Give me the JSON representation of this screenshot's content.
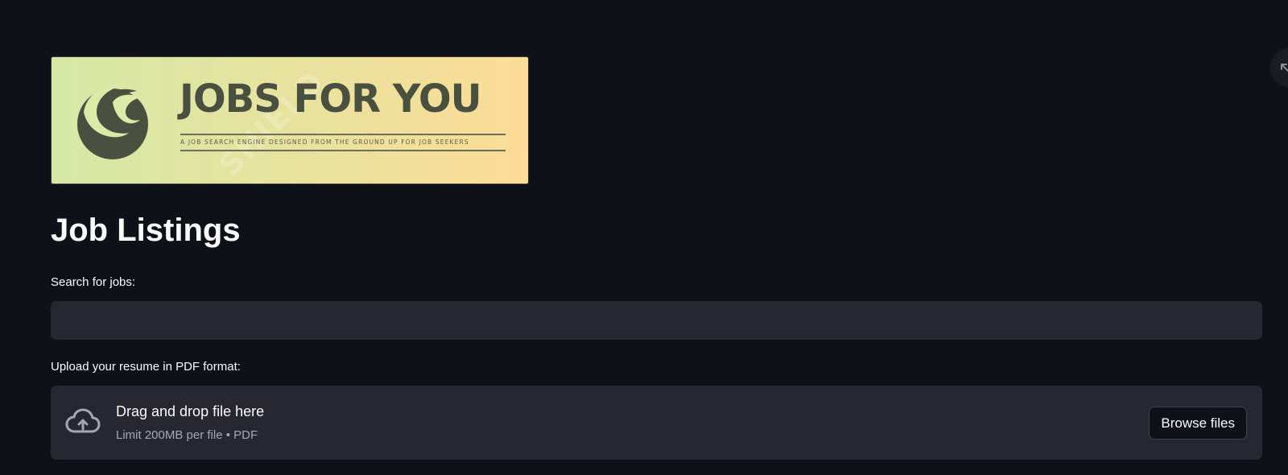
{
  "banner": {
    "wordmark": "JOBS FOR YOU",
    "tagline": "A JOB SEARCH ENGINE DESIGNED FROM THE GROUND UP FOR JOB SEEKERS",
    "watermark": "SHIELD"
  },
  "page": {
    "title": "Job Listings"
  },
  "search": {
    "label": "Search for jobs:",
    "value": "",
    "placeholder": ""
  },
  "upload": {
    "label": "Upload your resume in PDF format:",
    "dropzone_title": "Drag and drop file here",
    "dropzone_subtitle": "Limit 200MB per file • PDF",
    "browse_label": "Browse files",
    "icon": "cloud-upload-icon"
  },
  "header": {
    "corner_icon": "collapse-arrow-icon"
  },
  "colors": {
    "background": "#0e1117",
    "surface": "#262730",
    "text": "#fafafa",
    "muted_text": "#a3a8b8",
    "banner_gradient_start": "#d6e8a6",
    "banner_gradient_end": "#fcdc96",
    "logo_ink": "#4a5040"
  }
}
